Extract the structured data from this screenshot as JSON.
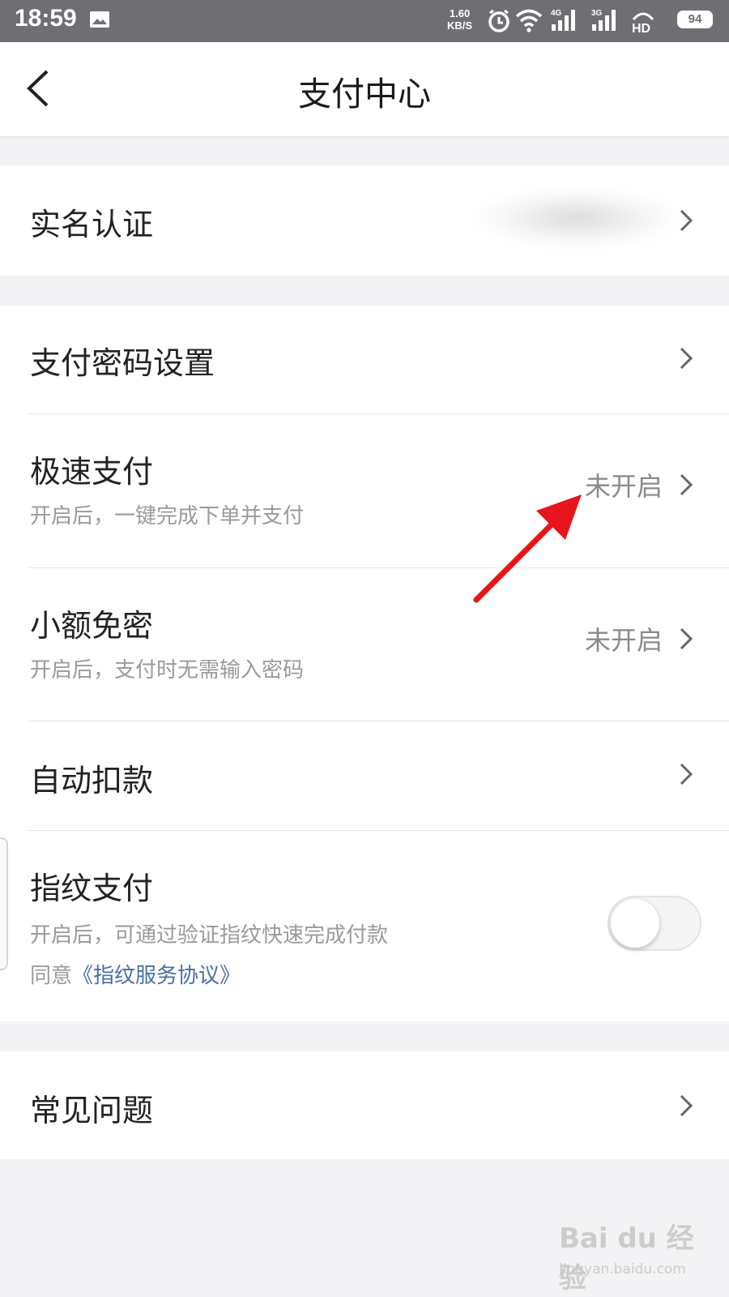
{
  "status_bar": {
    "time": "18:59",
    "speed_value": "1.60",
    "speed_unit": "KB/S",
    "network_4g": "4G",
    "network_3g": "3G",
    "hd": "HD",
    "battery": "94"
  },
  "header": {
    "title": "支付中心"
  },
  "group1": {
    "realname_label": "实名认证"
  },
  "group2": {
    "pay_password_label": "支付密码设置",
    "fast_pay": {
      "label": "极速支付",
      "sub": "开启后，一键完成下单并支付",
      "state": "未开启"
    },
    "small_free": {
      "label": "小额免密",
      "sub": "开启后，支付时无需输入密码",
      "state": "未开启"
    },
    "auto_deduct_label": "自动扣款",
    "fingerprint": {
      "label": "指纹支付",
      "sub": "开启后，可通过验证指纹快速完成付款",
      "agree_prefix": "同意",
      "agree_link": "《指纹服务协议》",
      "enabled": false
    }
  },
  "group3": {
    "faq_label": "常见问题"
  },
  "watermark": {
    "logo": "Bai du 经验",
    "url": "jingyan.baidu.com"
  },
  "colors": {
    "status_bar": "#6f6e73",
    "background": "#f3f2f5",
    "link": "#4a6fa8",
    "annotation_arrow": "#e8141b"
  }
}
